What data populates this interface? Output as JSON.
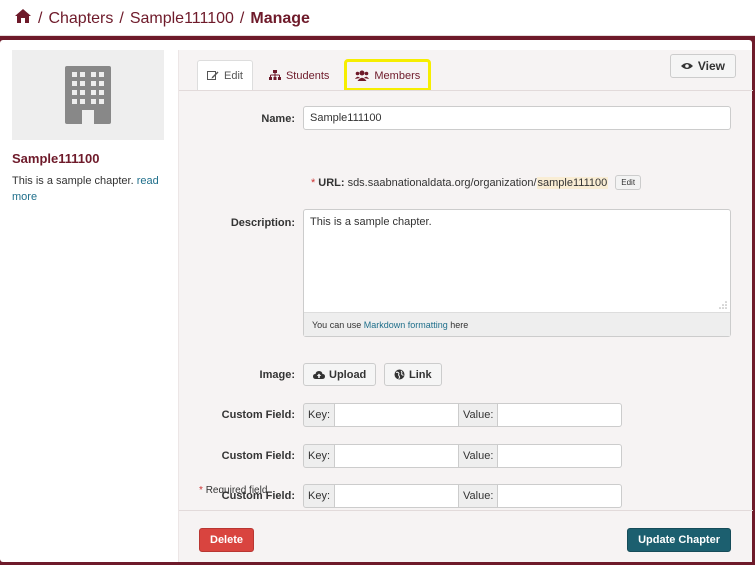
{
  "breadcrumb": {
    "home_icon": "home-icon",
    "items": [
      "Chapters",
      "Sample111100"
    ],
    "current": "Manage"
  },
  "sidebar": {
    "image_icon": "building-icon",
    "title": "Sample111100",
    "description": "This is a sample chapter.",
    "read_more": "read more"
  },
  "tabs": [
    {
      "label": "Edit",
      "icon": "edit-icon",
      "active": true
    },
    {
      "label": "Students",
      "icon": "sitemap-icon",
      "active": false
    },
    {
      "label": "Members",
      "icon": "users-icon",
      "active": false,
      "highlighted": true
    }
  ],
  "view_button": {
    "label": "View",
    "icon": "eye-icon"
  },
  "form": {
    "name_label": "Name:",
    "name_value": "Sample111100",
    "url_label": "URL:",
    "url_prefix": "sds.saabnationaldata.org/organization/",
    "url_slug": "sample111100",
    "url_edit": "Edit",
    "description_label": "Description:",
    "description_value": "This is a sample chapter.",
    "markdown_pre": "You can use",
    "markdown_link": "Markdown formatting",
    "markdown_post": "here",
    "image_label": "Image:",
    "upload_label": "Upload",
    "link_label": "Link",
    "custom_field_label": "Custom Field:",
    "key_label": "Key:",
    "value_label": "Value:",
    "required_note": "Required field"
  },
  "actions": {
    "delete": "Delete",
    "update": "Update Chapter"
  },
  "colors": {
    "brand": "#6e1a2a",
    "highlight": "#f6ee00",
    "delete": "#d9443f",
    "update": "#1c5f6f"
  }
}
